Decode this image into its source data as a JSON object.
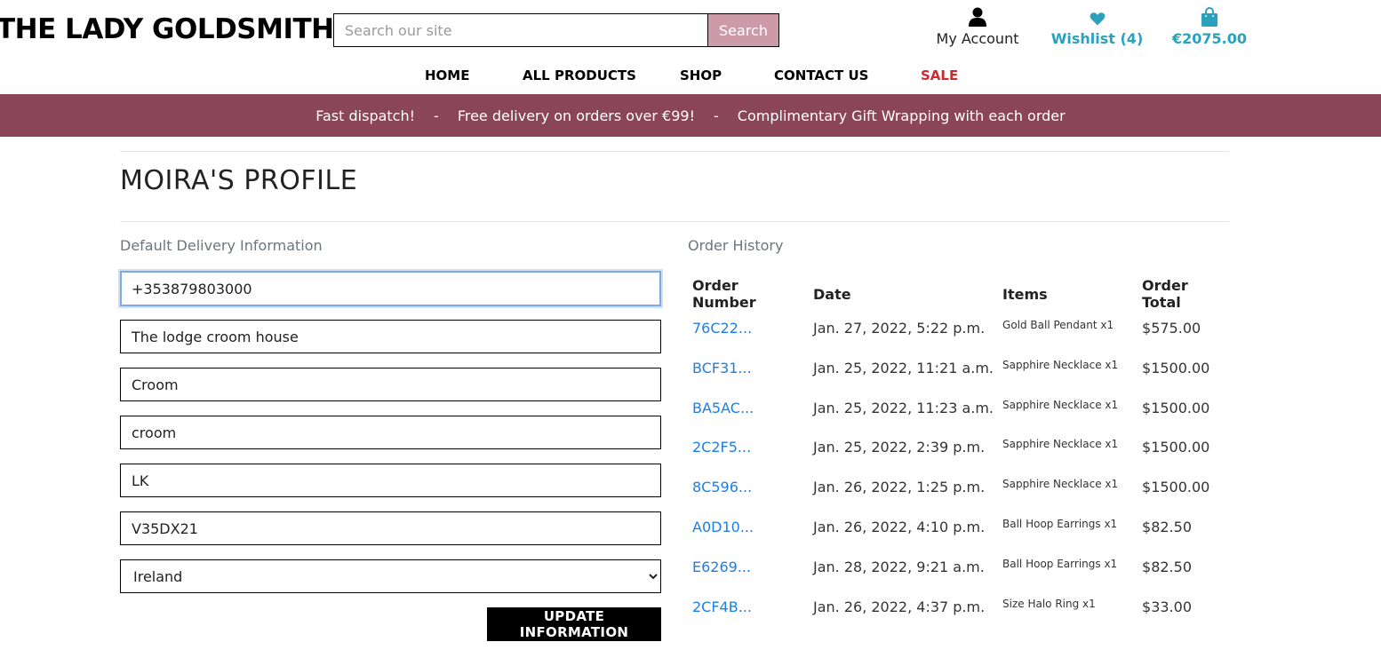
{
  "brand": "THE LADY GOLDSMITH",
  "search": {
    "placeholder": "Search our site",
    "button": "Search"
  },
  "account": {
    "my_account": "My Account",
    "wishlist": "Wishlist (4)",
    "bag_total": "€2075.00"
  },
  "nav": [
    "HOME",
    "ALL PRODUCTS",
    "SHOP",
    "CONTACT US",
    "SALE"
  ],
  "banner": [
    "Fast dispatch!",
    "-",
    "Free delivery on orders over €99!",
    "-",
    "Complimentary Gift Wrapping with each order"
  ],
  "profile": {
    "title": "MOIRA'S PROFILE",
    "delivery_heading": "Default Delivery Information",
    "fields": {
      "phone": "+353879803000",
      "address1": "The lodge croom house",
      "address2": "Croom",
      "town": "croom",
      "county": "LK",
      "postcode": "V35DX21",
      "country": "Ireland"
    },
    "update_button": "UPDATE INFORMATION"
  },
  "orders": {
    "heading": "Order History",
    "columns": [
      "Order Number",
      "Date",
      "Items",
      "Order Total"
    ],
    "rows": [
      {
        "number": "76C22...",
        "date": "Jan. 27, 2022, 5:22 p.m.",
        "items": "Gold Ball Pendant x1",
        "total": "$575.00"
      },
      {
        "number": "BCF31...",
        "date": "Jan. 25, 2022, 11:21 a.m.",
        "items": "Sapphire Necklace x1",
        "total": "$1500.00"
      },
      {
        "number": "BA5AC...",
        "date": "Jan. 25, 2022, 11:23 a.m.",
        "items": "Sapphire Necklace x1",
        "total": "$1500.00"
      },
      {
        "number": "2C2F5...",
        "date": "Jan. 25, 2022, 2:39 p.m.",
        "items": "Sapphire Necklace x1",
        "total": "$1500.00"
      },
      {
        "number": "8C596...",
        "date": "Jan. 26, 2022, 1:25 p.m.",
        "items": "Sapphire Necklace x1",
        "total": "$1500.00"
      },
      {
        "number": "A0D10...",
        "date": "Jan. 26, 2022, 4:10 p.m.",
        "items": "Ball Hoop Earrings x1",
        "total": "$82.50"
      },
      {
        "number": "E6269...",
        "date": "Jan. 28, 2022, 9:21 a.m.",
        "items": "Ball Hoop Earrings x1",
        "total": "$82.50"
      },
      {
        "number": "2CF4B...",
        "date": "Jan. 26, 2022, 4:37 p.m.",
        "items": "Size Halo Ring x1",
        "total": "$33.00"
      }
    ]
  },
  "colors": {
    "banner": "#8a4558",
    "accent": "#2aa2bd",
    "link": "#1e7ee6",
    "sale": "#d0282d",
    "search_button": "#cc9aa9"
  },
  "icons": {
    "account": "user-icon",
    "wishlist": "heart-icon",
    "bag": "shopping-bag-icon"
  }
}
